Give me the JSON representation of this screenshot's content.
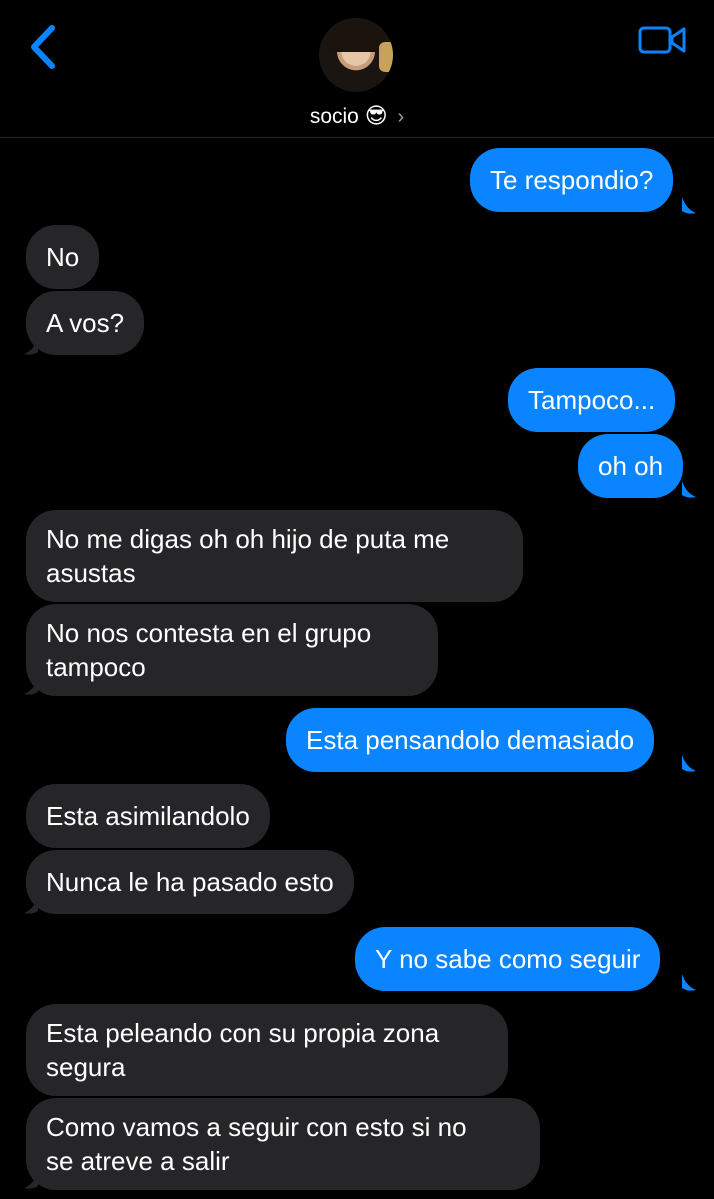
{
  "header": {
    "contact_name": "socio",
    "contact_emoji": "😎",
    "chevron": "›",
    "icons": {
      "back": "chevron-left-icon",
      "video": "video-camera-icon"
    }
  },
  "colors": {
    "outgoing": "#0a84ff",
    "incoming": "#262629",
    "accent": "#0a84ff",
    "background": "#000000"
  },
  "messages": [
    {
      "from": "me",
      "text": "Te respondio?"
    },
    {
      "from": "them",
      "text": "No"
    },
    {
      "from": "them",
      "text": "A vos?"
    },
    {
      "from": "me",
      "text": "Tampoco..."
    },
    {
      "from": "me",
      "text": "oh oh"
    },
    {
      "from": "them",
      "lines": [
        "No me digas oh oh hijo de puta me",
        "asustas"
      ]
    },
    {
      "from": "them",
      "lines": [
        "No nos contesta en el grupo",
        "tampoco"
      ]
    },
    {
      "from": "me",
      "text": "Esta pensandolo demasiado"
    },
    {
      "from": "them",
      "text": "Esta asimilandolo"
    },
    {
      "from": "them",
      "text": "Nunca le ha pasado esto"
    },
    {
      "from": "me",
      "text": "Y no sabe como seguir"
    },
    {
      "from": "them",
      "lines": [
        "Esta peleando con su propia zona",
        "segura"
      ]
    },
    {
      "from": "them",
      "lines": [
        "Como vamos a seguir con esto si no",
        "se atreve a salir"
      ]
    }
  ]
}
